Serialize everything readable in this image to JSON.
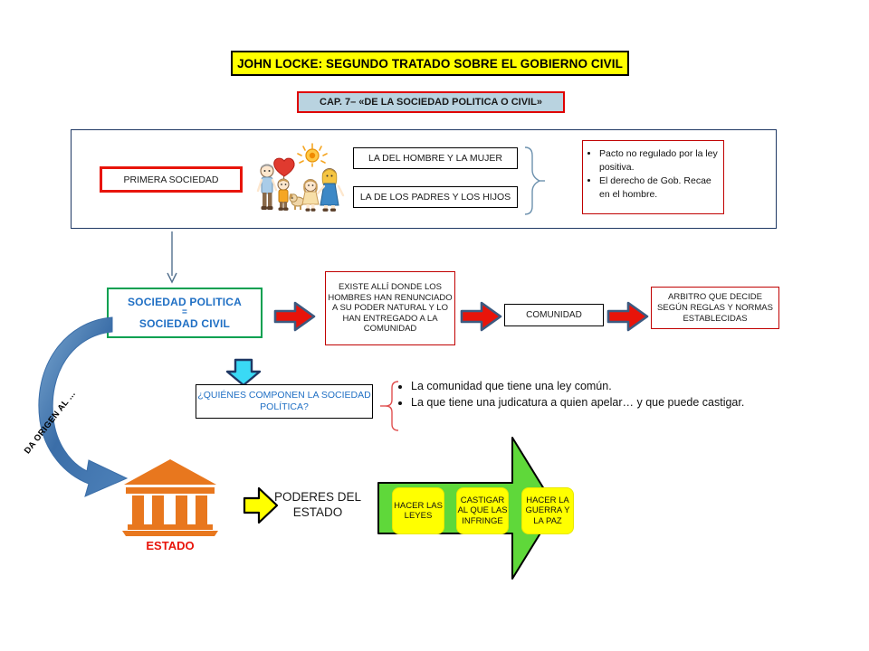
{
  "title": "JOHN LOCKE: SEGUNDO TRATADO SOBRE EL GOBIERNO CIVIL",
  "subtitle": "CAP. 7– «DE LA SOCIEDAD POLITICA O CIVIL»",
  "first_society": {
    "label": "PRIMERA  SOCIEDAD",
    "types": [
      "LA DEL HOMBRE Y LA MUJER",
      "LA DE LOS PADRES Y LOS HIJOS"
    ],
    "notes": [
      "Pacto no regulado por la ley positiva.",
      "El derecho de Gob. Recae en el hombre."
    ]
  },
  "political_society": {
    "line1": "SOCIEDAD    POLITICA",
    "equals": "=",
    "line2": "SOCIEDAD CIVIL",
    "definition": "EXISTE ALLÍ DONDE LOS HOMBRES HAN RENUNCIADO A SU PODER NATURAL  Y LO HAN ENTREGADO A LA COMUNIDAD",
    "community": "COMUNIDAD",
    "arbiter": "ARBITRO QUE DECIDE SEGÚN REGLAS Y NORMAS ESTABLECIDAS"
  },
  "question": {
    "text": "¿QUIÉNES COMPONEN LA SOCIEDAD POLÍTICA?",
    "answers": [
      "La comunidad que tiene una ley común.",
      "La que tiene una judicatura a quien apelar… y que puede castigar."
    ]
  },
  "state": {
    "origin_label": "DA ORIGEN AL ...",
    "label": "ESTADO",
    "powers_label": "PODERES DEL ESTADO",
    "powers": [
      "HACER LAS LEYES",
      "CASTIGAR AL QUE LAS INFRINGE",
      "HACER LA GUERRA Y LA PAZ"
    ]
  },
  "colors": {
    "title_bg": "#FFFF00",
    "subtitle_bg": "#B9D3E0",
    "red_border": "#C00000",
    "green_border": "#00A050",
    "blue_text": "#1F6FC4",
    "red_arrow": "#E8140A",
    "cyan_arrow": "#33DDFF",
    "yellow_arrow": "#FFFF00",
    "green_arrow": "#5FD83A",
    "orange_temple": "#E8771E",
    "navy_outline": "#3C5A80"
  },
  "icons": {
    "family": "family-clipart",
    "temple": "temple-icon"
  }
}
